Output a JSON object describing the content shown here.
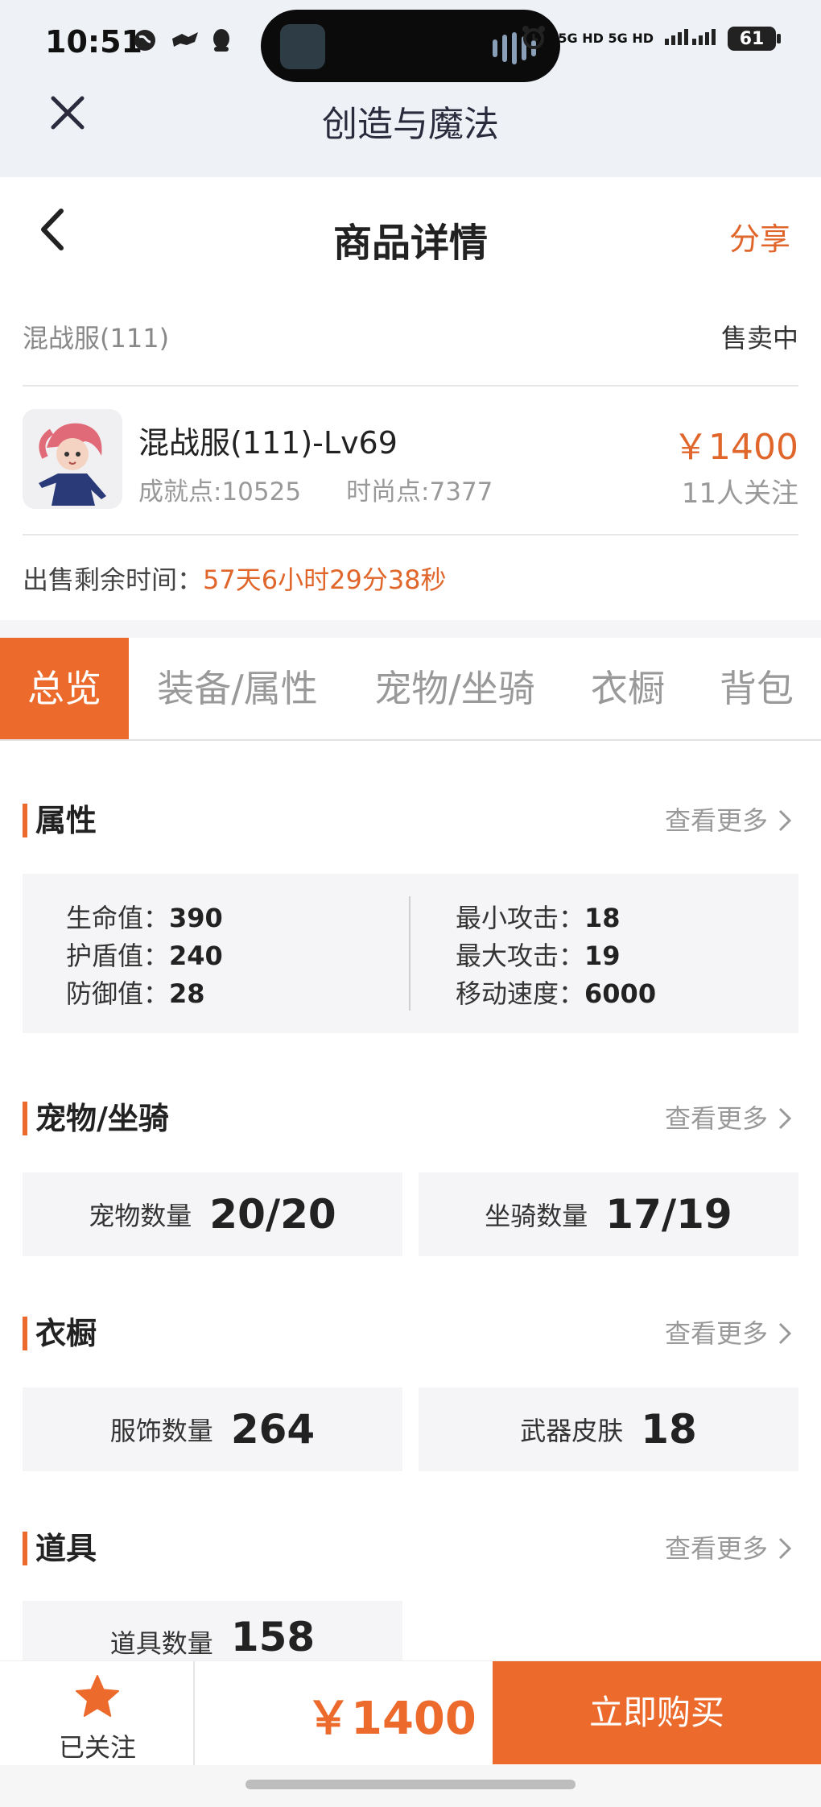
{
  "status_bar": {
    "time": "10:51",
    "network": "5G HD 5G HD",
    "battery": "61"
  },
  "app": {
    "title": "创造与魔法",
    "close_icon": "close-icon"
  },
  "header": {
    "title": "商品详情",
    "share_label": "分享",
    "back_icon": "chevron-left-icon"
  },
  "product": {
    "server": "混战服(111)",
    "status": "售卖中",
    "name": "混战服(111)-Lv69",
    "achievement": "成就点:10525",
    "fashion": "时尚点:7377",
    "price": "￥1400",
    "followers": "11人关注",
    "remaining_label": "出售剩余时间：",
    "remaining_value": "57天6小时29分38秒"
  },
  "tabs": [
    "总览",
    "装备/属性",
    "宠物/坐骑",
    "衣橱",
    "背包"
  ],
  "sections": {
    "attributes": {
      "title": "属性",
      "more": "查看更多",
      "left": [
        {
          "label": "生命值：",
          "value": "390"
        },
        {
          "label": "护盾值：",
          "value": "240"
        },
        {
          "label": "防御值：",
          "value": "28"
        }
      ],
      "right": [
        {
          "label": "最小攻击：",
          "value": "18"
        },
        {
          "label": "最大攻击：",
          "value": "19"
        },
        {
          "label": "移动速度：",
          "value": "6000"
        }
      ]
    },
    "pets": {
      "title": "宠物/坐骑",
      "more": "查看更多",
      "items": [
        {
          "label": "宠物数量",
          "value": "20/20"
        },
        {
          "label": "坐骑数量",
          "value": "17/19"
        }
      ]
    },
    "wardrobe": {
      "title": "衣橱",
      "more": "查看更多",
      "items": [
        {
          "label": "服饰数量",
          "value": "264"
        },
        {
          "label": "武器皮肤",
          "value": "18"
        }
      ]
    },
    "props": {
      "title": "道具",
      "more": "查看更多",
      "items": [
        {
          "label": "道具数量",
          "value": "158"
        }
      ]
    }
  },
  "bottom_bar": {
    "follow_label": "已关注",
    "price": "￥1400",
    "buy_label": "立即购买"
  },
  "colors": {
    "accent": "#ec6a2c",
    "text": "#222222",
    "muted": "#999999",
    "panel": "#f5f5f7"
  }
}
